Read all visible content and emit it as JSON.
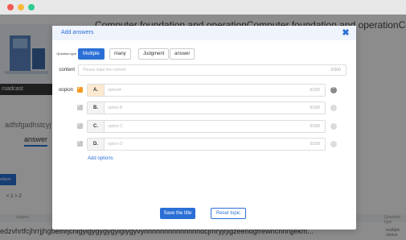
{
  "window": {
    "controls": [
      "close",
      "minimize",
      "maximize"
    ]
  },
  "background": {
    "page_title": "Computer foundation and operationComputer foundation and operationComput",
    "sidebar_label": "roadcast",
    "subtitle": "adfsfgadhstcyj",
    "active_tab": "answer",
    "button_label": "educe",
    "pager": "<  1  >  2",
    "row_header_left": "subject",
    "row_header_right": "Question type",
    "bottom_text": "edzvhrtfcjhrrjjhgbefnrjcnigyigygygygyigiygyvyhhhhhhhhhhhhhhdcjrnryjrjigzeehdgfrewnchnnjjekm...",
    "bottom_right": "multiple choice"
  },
  "modal": {
    "title": "Add answers",
    "close_icon": "close-icon",
    "question_type_label": "Question type",
    "question_types": [
      {
        "label": "Multiple",
        "active": true
      },
      {
        "label": "many",
        "active": false
      },
      {
        "label": "Judgment",
        "active": false
      },
      {
        "label": "answer",
        "active": false
      }
    ],
    "content_label": "content",
    "content_placeholder": "Please input the content",
    "content_count": "0/300",
    "option_label": "oopion",
    "options": [
      {
        "letter": "A.",
        "placeholder": "optionA",
        "count": "0/100",
        "checked": true,
        "removable": true
      },
      {
        "letter": "B.",
        "placeholder": "option B",
        "count": "0/100",
        "checked": false,
        "removable": false
      },
      {
        "letter": "C.",
        "placeholder": "option C",
        "count": "0/100",
        "checked": false,
        "removable": false
      },
      {
        "letter": "D.",
        "placeholder": "option D",
        "count": "0/100",
        "checked": false,
        "removable": false
      }
    ],
    "add_options_label": "Add options",
    "save_label": "Save the title",
    "reset_label": "Reset topic"
  },
  "colors": {
    "primary": "#2b6fd6",
    "checked": "#f59a23",
    "overlay": "rgba(0,0,0,0.45)"
  }
}
